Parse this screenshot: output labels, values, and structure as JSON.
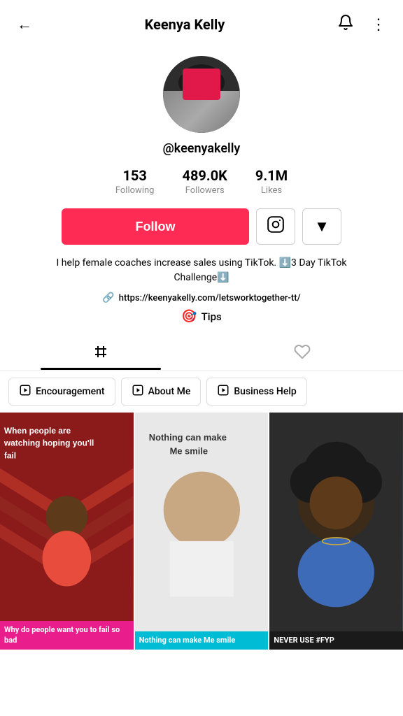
{
  "header": {
    "title": "Keenya Kelly",
    "back_label": "←",
    "notification_icon": "bell",
    "more_icon": "ellipsis"
  },
  "profile": {
    "username": "@keenyakelly",
    "avatar_alt": "Keenya Kelly profile photo"
  },
  "stats": [
    {
      "value": "153",
      "label": "Following"
    },
    {
      "value": "489.0K",
      "label": "Followers"
    },
    {
      "value": "9.1M",
      "label": "Likes"
    }
  ],
  "actions": {
    "follow_label": "Follow",
    "instagram_icon": "instagram",
    "dropdown_icon": "▼"
  },
  "bio": {
    "text": "I help female coaches increase sales using TikTok. ⬇️3 Day TikTok Challenge⬇️",
    "link": "https://keenyakelly.com/letsworktogether-tt/",
    "tips_label": "Tips"
  },
  "tabs": [
    {
      "id": "grid",
      "icon": "⊞",
      "active": true
    },
    {
      "id": "liked",
      "icon": "♡",
      "active": false
    }
  ],
  "playlists": [
    {
      "label": "Encouragement",
      "icon": "▶"
    },
    {
      "label": "About Me",
      "icon": "▶"
    },
    {
      "label": "Business Help",
      "icon": "▶"
    }
  ],
  "videos": [
    {
      "id": "v1",
      "overlay_text": "When people are watching hoping you'll fail",
      "caption": "Why do people want you to fail so bad",
      "caption_style": "pink-bg",
      "bg": "red"
    },
    {
      "id": "v2",
      "overlay_text": "Nothing can make Me smile",
      "caption": "Nothing can make Me smile",
      "caption_style": "teal-bg",
      "bg": "light"
    },
    {
      "id": "v3",
      "overlay_text": "",
      "caption": "NEVER USE #FYP",
      "caption_style": "dark-bg",
      "bg": "dark"
    }
  ]
}
